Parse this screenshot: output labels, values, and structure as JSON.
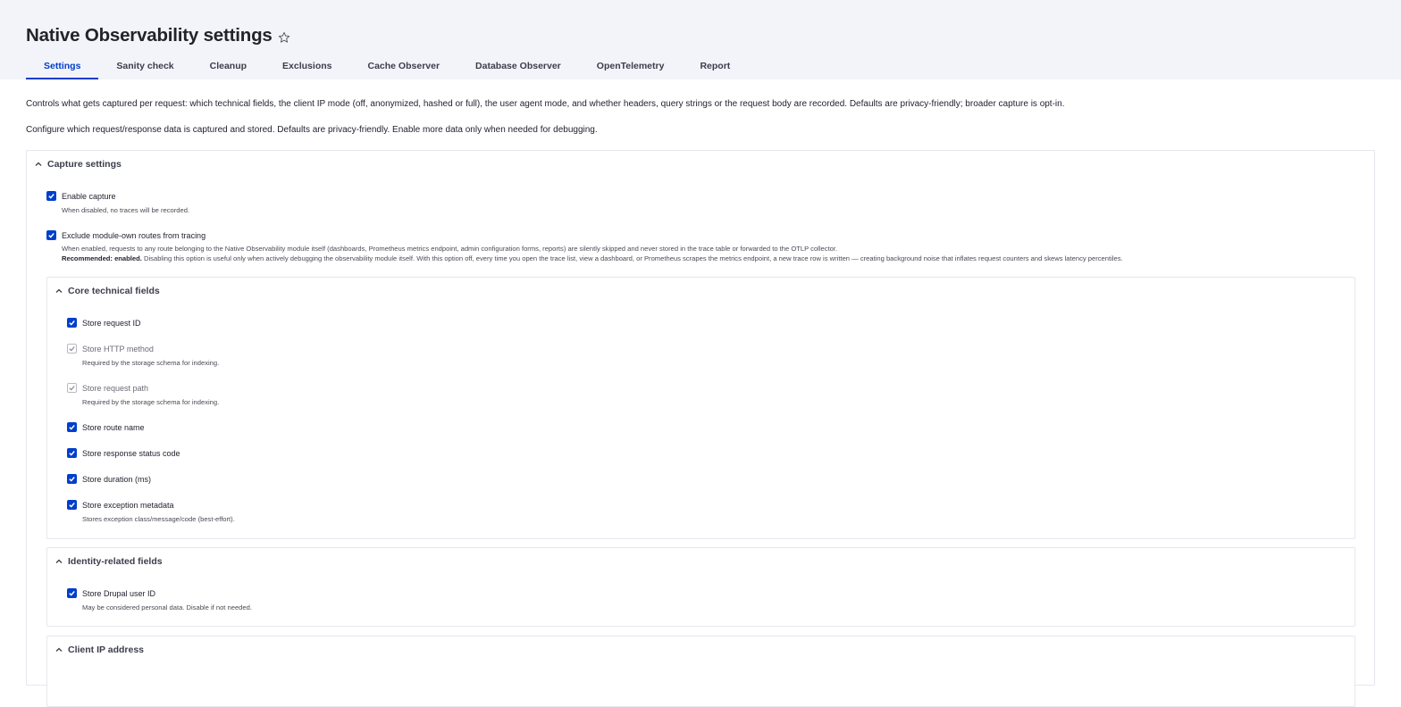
{
  "page": {
    "title": "Native Observability settings"
  },
  "tabs": [
    {
      "label": "Settings",
      "active": true
    },
    {
      "label": "Sanity check"
    },
    {
      "label": "Cleanup"
    },
    {
      "label": "Exclusions"
    },
    {
      "label": "Cache Observer"
    },
    {
      "label": "Database Observer"
    },
    {
      "label": "OpenTelemetry"
    },
    {
      "label": "Report"
    }
  ],
  "descriptions": {
    "intro": "Controls what gets captured per request: which technical fields, the client IP mode (off, anonymized, hashed or full), the user agent mode, and whether headers, query strings or the request body are recorded. Defaults are privacy-friendly; broader capture is opt-in.",
    "configure": "Configure which request/response data is captured and stored. Defaults are privacy-friendly. Enable more data only when needed for debugging."
  },
  "capture_settings": {
    "title": "Capture settings",
    "enable_capture": {
      "label": "Enable capture",
      "help": "When disabled, no traces will be recorded.",
      "checked": true
    },
    "exclude_routes": {
      "label": "Exclude module-own routes from tracing",
      "help1": "When enabled, requests to any route belonging to the Native Observability module itself (dashboards, Prometheus metrics endpoint, admin configuration forms, reports) are silently skipped and never stored in the trace table or forwarded to the OTLP collector.",
      "help2_strong": "Recommended: enabled.",
      "help2_rest": " Disabling this option is useful only when actively debugging the observability module itself. With this option off, every time you open the trace list, view a dashboard, or Prometheus scrapes the metrics endpoint, a new trace row is written — creating background noise that inflates request counters and skews latency percentiles.",
      "checked": true
    }
  },
  "core_fields": {
    "title": "Core technical fields",
    "items": [
      {
        "label": "Store request ID",
        "checked": true,
        "disabled": false
      },
      {
        "label": "Store HTTP method",
        "help": "Required by the storage schema for indexing.",
        "checked": true,
        "disabled": true
      },
      {
        "label": "Store request path",
        "help": "Required by the storage schema for indexing.",
        "checked": true,
        "disabled": true
      },
      {
        "label": "Store route name",
        "checked": true,
        "disabled": false
      },
      {
        "label": "Store response status code",
        "checked": true,
        "disabled": false
      },
      {
        "label": "Store duration (ms)",
        "checked": true,
        "disabled": false
      },
      {
        "label": "Store exception metadata",
        "help": "Stores exception class/message/code (best-effort).",
        "checked": true,
        "disabled": false
      }
    ]
  },
  "identity_fields": {
    "title": "Identity-related fields",
    "items": [
      {
        "label": "Store Drupal user ID",
        "help": "May be considered personal data. Disable if not needed.",
        "checked": true
      }
    ]
  },
  "client_ip": {
    "title": "Client IP address"
  },
  "colors": {
    "accent": "#003ecc",
    "header_bg": "#f3f4f9",
    "border": "#e6e7ee"
  }
}
